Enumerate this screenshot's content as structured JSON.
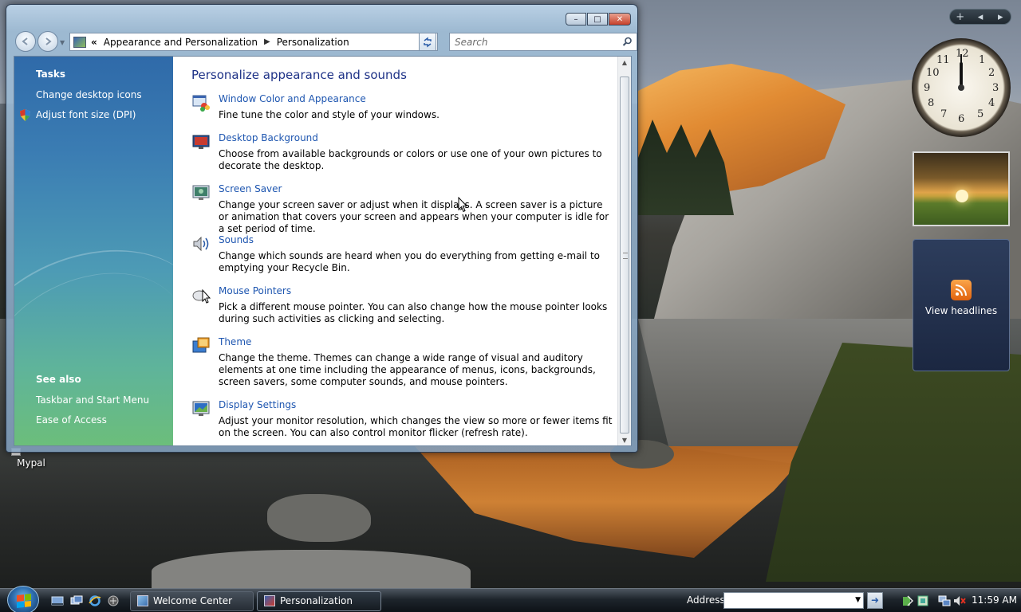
{
  "window": {
    "breadcrumb_chevron": "«",
    "breadcrumb": [
      "Appearance and Personalization",
      "Personalization"
    ],
    "search_placeholder": "Search",
    "controls": {
      "minimize": "–",
      "maximize": "□",
      "close": "✕"
    }
  },
  "left_pane": {
    "tasks_heading": "Tasks",
    "tasks": [
      "Change desktop icons",
      "Adjust font size (DPI)"
    ],
    "see_also_heading": "See also",
    "see_also": [
      "Taskbar and Start Menu",
      "Ease of Access"
    ]
  },
  "content": {
    "heading": "Personalize appearance and sounds",
    "items": [
      {
        "title": "Window Color and Appearance",
        "desc": "Fine tune the color and style of your windows.",
        "icon": "window-color-icon"
      },
      {
        "title": "Desktop Background",
        "desc": "Choose from available backgrounds or colors or use one of your own pictures to decorate the desktop.",
        "icon": "desktop-background-icon"
      },
      {
        "title": "Screen Saver",
        "desc": "Change your screen saver or adjust when it displays. A screen saver is a picture or animation that covers your screen and appears when your computer is idle for a set period of time.",
        "icon": "screen-saver-icon"
      },
      {
        "title": "Sounds",
        "desc": "Change which sounds are heard when you do everything from getting e-mail to emptying your Recycle Bin.",
        "icon": "sounds-icon"
      },
      {
        "title": "Mouse Pointers",
        "desc": "Pick a different mouse pointer. You can also change how the mouse pointer looks during such activities as clicking and selecting.",
        "icon": "mouse-pointers-icon"
      },
      {
        "title": "Theme",
        "desc": "Change the theme. Themes can change a wide range of visual and auditory elements at one time including the appearance of menus, icons, backgrounds, screen savers, some computer sounds, and mouse pointers.",
        "icon": "theme-icon"
      },
      {
        "title": "Display Settings",
        "desc": "Adjust your monitor resolution, which changes the view so more or fewer items fit on the screen. You can also control monitor flicker (refresh rate).",
        "icon": "display-settings-icon"
      }
    ]
  },
  "desktop": {
    "icon_label": "Mypal"
  },
  "gadgets": {
    "sidebar_controls": [
      "+",
      "◂",
      "▸"
    ],
    "clock_numbers": [
      "12",
      "1",
      "2",
      "3",
      "4",
      "5",
      "6",
      "7",
      "8",
      "9",
      "10",
      "11"
    ],
    "feed_label": "View headlines"
  },
  "taskbar": {
    "tasks": [
      "Welcome Center",
      "Personalization"
    ],
    "address_label": "Address",
    "address_value": "",
    "go_arrow": "➜",
    "time": "11:59 AM"
  },
  "colors": {
    "link": "#1e56b0",
    "heading": "#1e3287",
    "pane_top": "#2f6aa9",
    "pane_bottom": "#6cbe7a"
  }
}
